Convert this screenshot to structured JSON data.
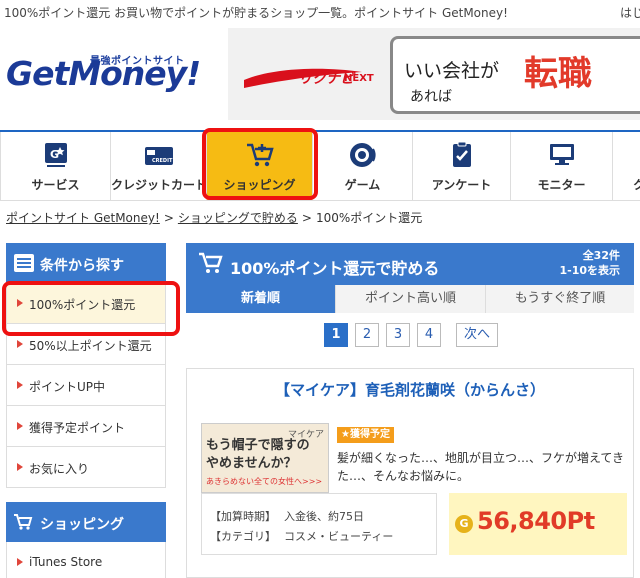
{
  "top": {
    "tagline": "100%ポイント還元 お買い物でポイントが貯まるショップ一覧。ポイントサイト GetMoney!",
    "right_link": "はじ"
  },
  "logo": {
    "main": "GetMoney!",
    "sub": "最強ポイントサイト"
  },
  "banner": {
    "brand": "リクナビ",
    "brand_suffix": "NEXT",
    "copy1": "いい会社が",
    "copy2": "あれば",
    "copy3": "転職"
  },
  "categories": [
    {
      "label": "サービス",
      "icon": "service-icon"
    },
    {
      "label": "クレジットカード",
      "icon": "credit-card-icon"
    },
    {
      "label": "ショッピング",
      "icon": "shopping-cart-icon",
      "active": true
    },
    {
      "label": "ゲーム",
      "icon": "game-icon"
    },
    {
      "label": "アンケート",
      "icon": "survey-icon"
    },
    {
      "label": "モニター",
      "icon": "monitor-icon"
    },
    {
      "label": "ク",
      "icon": "other-icon"
    }
  ],
  "breadcrumb": {
    "home": "ポイントサイト GetMoney!",
    "parent": "ショッピングで貯める",
    "current": "100%ポイント還元",
    "sep": ">"
  },
  "sidebar": {
    "search_title": "条件から探す",
    "items": [
      {
        "label": "100%ポイント還元",
        "active": true
      },
      {
        "label": "50%以上ポイント還元"
      },
      {
        "label": "ポイントUP中"
      },
      {
        "label": "獲得予定ポイント"
      },
      {
        "label": "お気に入り"
      }
    ],
    "shopping_title": "ショッピング",
    "shopping_items": [
      {
        "label": "iTunes Store"
      }
    ]
  },
  "main": {
    "title": "100%ポイント還元で貯める",
    "total": "全32件",
    "range": "1-10を表示",
    "sort_tabs": [
      "新着順",
      "ポイント高い順",
      "もうすぐ終了順"
    ],
    "pages": [
      "1",
      "2",
      "3",
      "4"
    ],
    "next": "次へ"
  },
  "offer": {
    "title": "【マイケア】育毛剤花蘭咲（からんさ）",
    "thumb_brand": "マイケア",
    "thumb_line1": "もう帽子で隠すの",
    "thumb_line2": "やめませんか？",
    "thumb_line3": "あきらめない全ての女性へ>>>",
    "badge": "★獲得予定",
    "desc": "髪が細くなった…、地肌が目立つ…、フケが増えてきた…、そんなお悩みに。",
    "period_key": "【加算時期】",
    "period_val": "入金後、約75日",
    "category_key": "【カテゴリ】",
    "category_val": "コスメ・ビューティー",
    "coin": "G",
    "points": "56,840Pt"
  },
  "colors": {
    "brand_blue": "#3a79cc",
    "active_yellow": "#f6bb13",
    "highlight_red": "#e11111",
    "points_red": "#e13b27"
  }
}
